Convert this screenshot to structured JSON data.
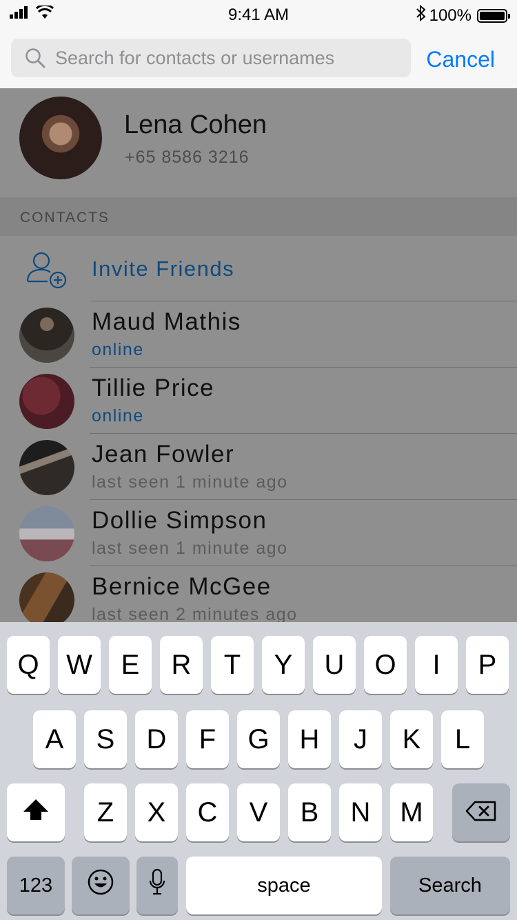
{
  "status_bar": {
    "time": "9:41 AM",
    "battery": "100%"
  },
  "search": {
    "placeholder": "Search for contacts or usernames",
    "cancel_label": "Cancel"
  },
  "me": {
    "name": "Lena Cohen",
    "phone": "+65 8586 3216"
  },
  "contacts_section": {
    "title": "CONTACTS",
    "invite_label": "Invite Friends",
    "items": [
      {
        "name": "Maud Mathis",
        "status": "online"
      },
      {
        "name": "Tillie Price",
        "status": "online"
      },
      {
        "name": "Jean Fowler",
        "status": "last seen 1 minute ago"
      },
      {
        "name": "Dollie Simpson",
        "status": "last seen 1 minute ago"
      },
      {
        "name": "Bernice McGee",
        "status": "last seen 2 minutes ago"
      }
    ]
  },
  "keyboard": {
    "row1": [
      "Q",
      "W",
      "E",
      "R",
      "T",
      "Y",
      "U",
      "O",
      "I",
      "P"
    ],
    "row2": [
      "A",
      "S",
      "D",
      "F",
      "G",
      "H",
      "J",
      "K",
      "L"
    ],
    "row3": [
      "Z",
      "X",
      "C",
      "V",
      "B",
      "N",
      "M"
    ],
    "numbers_label": "123",
    "space_label": "space",
    "search_label": "Search"
  },
  "colors": {
    "accent": "#007aff",
    "link_dimmed": "#0f4a7e",
    "overlay": "#8f8f8f",
    "keyboard_bg": "#d1d4da"
  }
}
